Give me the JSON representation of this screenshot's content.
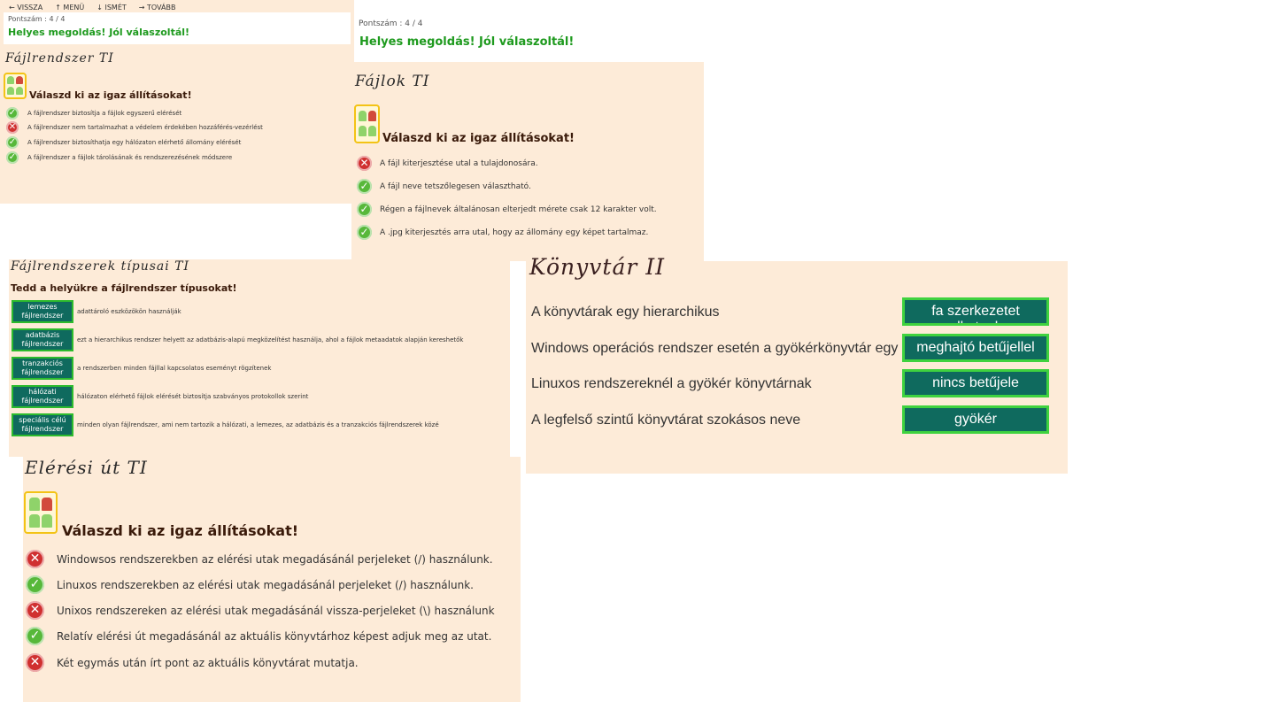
{
  "panel1": {
    "nav": [
      "← VISSZA",
      "↑ MENÜ",
      "↓ ISMÉT",
      "→ TOVÁBB"
    ],
    "score": "Pontszám : 4 / 4",
    "feedback": "Helyes megoldás! Jól válaszoltál!",
    "title": "Fájlrendszer TI",
    "question": "Válaszd ki az igaz állításokat!",
    "statements": [
      {
        "text": "A fájlrendszer biztosítja a fájlok egyszerű elérését",
        "correct": true
      },
      {
        "text": "A fájlrendszer nem tartalmazhat a védelem érdekében hozzáférés-vezérlést",
        "correct": false
      },
      {
        "text": "A fájlrendszer biztosíthatja egy hálózaton elérhető állomány elérését",
        "correct": true
      },
      {
        "text": "A fájlrendszer a fájlok tárolásának és rendszerezésének módszere",
        "correct": true
      }
    ]
  },
  "panel2": {
    "score": "Pontszám : 4 / 4",
    "feedback": "Helyes megoldás! Jól válaszoltál!",
    "title": "Fájlok TI",
    "question": "Válaszd ki az igaz állításokat!",
    "statements": [
      {
        "text": "A fájl kiterjesztése utal a tulajdonosára.",
        "correct": false
      },
      {
        "text": "A fájl neve tetszőlegesen választható.",
        "correct": true
      },
      {
        "text": "Régen a fájlnevek általánosan elterjedt mérete csak 12 karakter volt.",
        "correct": true
      },
      {
        "text": "A .jpg kiterjesztés arra utal, hogy az állomány egy képet tartalmaz.",
        "correct": true
      }
    ]
  },
  "panel3": {
    "title": "Fájlrendszerek típusai TI",
    "instruction": "Tedd a helyükre a fájlrendszer típusokat!",
    "items": [
      {
        "tag": "lemezes fájlrendszer",
        "text": "adattároló eszközökön használják"
      },
      {
        "tag": "adatbázis fájlrendszer",
        "text": "ezt a hierarchikus rendszer helyett az adatbázis-alapú megközelítést használja, ahol a fájlok metaadatok alapján kereshetők"
      },
      {
        "tag": "tranzakciós fájlrendszer",
        "text": "a rendszerben minden fájllal kapcsolatos eseményt rögzítenek"
      },
      {
        "tag": "hálózati fájlrendszer",
        "text": "hálózaton elérhető fájlok elérését biztosítja szabványos protokollok szerint"
      },
      {
        "tag": "speciális célú fájlrendszer",
        "text": "minden olyan fájlrendszer, ami nem tartozik a hálózati, a lemezes, az adatbázis és a tranzakciós fájlrendszerek közé"
      }
    ]
  },
  "panel4": {
    "title": "Könyvtár II",
    "rows": [
      {
        "text": "A könyvtárak egy hierarchikus",
        "answer": "fa szerkezetet alkotnak"
      },
      {
        "text": "Windows operációs rendszer esetén a gyökérkönyvtár egy",
        "answer": "meghajtó betűjellel"
      },
      {
        "text": "Linuxos rendszereknél a gyökér könyvtárnak",
        "answer": "nincs betűjele"
      },
      {
        "text": "A legfelső szintű könyvtárat szokásos neve",
        "answer": "gyökér"
      }
    ]
  },
  "panel5": {
    "title": "Elérési út TI",
    "question": "Válaszd ki az igaz állításokat!",
    "statements": [
      {
        "text": "Windowsos rendszerekben az elérési utak megadásánál perjeleket (/) használunk.",
        "correct": false
      },
      {
        "text": "Linuxos rendszerekben az elérési utak megadásánál perjeleket (/) használunk.",
        "correct": true
      },
      {
        "text": "Unixos rendszereken az elérési utak megadásánál vissza-perjeleket (\\) használunk",
        "correct": false
      },
      {
        "text": "Relatív elérési út megadásánál az aktuális könyvtárhoz képest adjuk meg az utat.",
        "correct": true
      },
      {
        "text": "Két egymás után írt pont az aktuális könyvtárat mutatja.",
        "correct": false
      }
    ]
  }
}
